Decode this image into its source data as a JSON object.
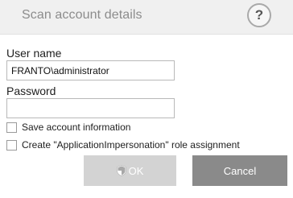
{
  "dialog": {
    "title": "Scan account details",
    "help_label": "?"
  },
  "form": {
    "username_label": "User name",
    "username_value": "FRANTO\\administrator",
    "password_label": "Password",
    "password_value": ""
  },
  "checkboxes": [
    {
      "label": "Save account information",
      "checked": false
    },
    {
      "label": "Create \"ApplicationImpersonation\" role assignment",
      "checked": false
    }
  ],
  "buttons": {
    "ok_label": "OK",
    "ok_disabled": true,
    "cancel_label": "Cancel"
  },
  "colors": {
    "ok_disabled_bg": "#d3d3d3",
    "cancel_bg": "#8a8a8a"
  }
}
